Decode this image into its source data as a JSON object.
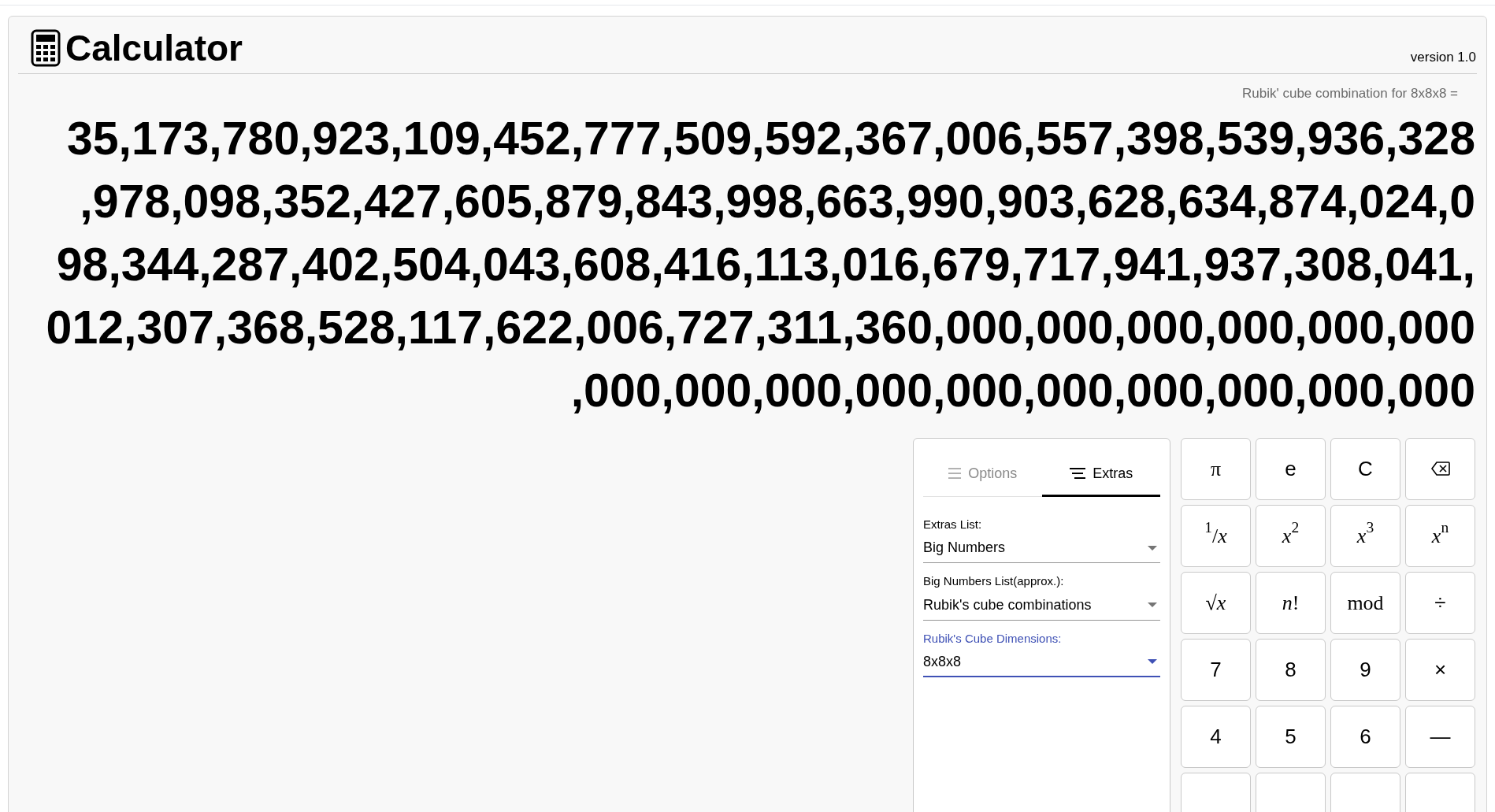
{
  "header": {
    "title": "Calculator",
    "version": "version 1.0"
  },
  "expression": "Rubik' cube combination for 8x8x8 =",
  "result_lines": [
    "35,173,780,923,109,452,777,509,592,367,006,557,398,539,936,328",
    ",978,098,352,427,605,879,843,998,663,990,903,628,634,874,024,0",
    "98,344,287,402,504,043,608,416,113,016,679,717,941,937,308,041,",
    "012,307,368,528,117,622,006,727,311,360,000,000,000,000,000,000",
    ",000,000,000,000,000,000,000,000,000,000"
  ],
  "panel": {
    "tabs": [
      {
        "label": "Options",
        "selected": false
      },
      {
        "label": "Extras",
        "selected": true
      }
    ],
    "fields": [
      {
        "label": "Extras List:",
        "value": "Big Numbers",
        "focused": false
      },
      {
        "label": "Big Numbers List(approx.):",
        "value": "Rubik's cube combinations",
        "focused": false
      },
      {
        "label": "Rubik's Cube Dimensions:",
        "value": "8x8x8",
        "focused": true
      }
    ]
  },
  "keys": [
    {
      "kind": "math",
      "label": "π"
    },
    {
      "kind": "text",
      "label": "e"
    },
    {
      "kind": "text",
      "label": "C"
    },
    {
      "kind": "backspace"
    },
    {
      "kind": "math",
      "label": "$^{1}$/*x*"
    },
    {
      "kind": "math",
      "label": "*x*$^{2}$"
    },
    {
      "kind": "math",
      "label": "*x*$^{3}$"
    },
    {
      "kind": "math",
      "label": "*x*$^{n}$"
    },
    {
      "kind": "math",
      "label": "√*x*"
    },
    {
      "kind": "math",
      "label": "*n*!"
    },
    {
      "kind": "math",
      "label": "mod"
    },
    {
      "kind": "text",
      "label": "÷"
    },
    {
      "kind": "text",
      "label": "7"
    },
    {
      "kind": "text",
      "label": "8"
    },
    {
      "kind": "text",
      "label": "9"
    },
    {
      "kind": "text",
      "label": "×"
    },
    {
      "kind": "text",
      "label": "4"
    },
    {
      "kind": "text",
      "label": "5"
    },
    {
      "kind": "text",
      "label": "6"
    },
    {
      "kind": "text",
      "label": "—"
    }
  ]
}
